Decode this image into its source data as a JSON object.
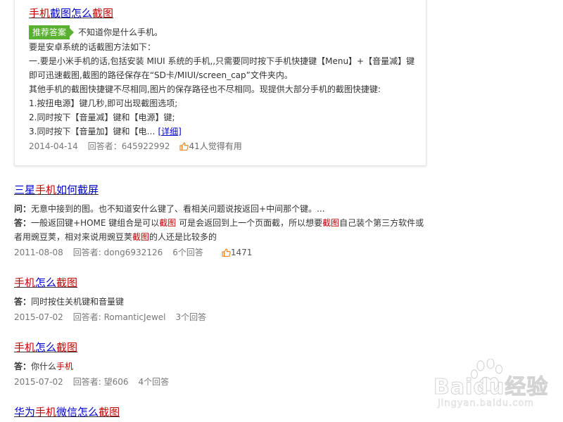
{
  "featured": {
    "title_parts": [
      {
        "text": "手机",
        "hl": true
      },
      {
        "text": "截图",
        "hl": false
      },
      {
        "text": "怎么",
        "hl": false
      },
      {
        "text": "截图",
        "hl": true
      }
    ],
    "badge": "推荐答案",
    "intro": "不知道你是什么手机。",
    "lines": [
      "要是安卓系统的话截图方法如下：",
      "一.要是小米手机的话,包括安装 MIUI 系统的手机,,只需要同时按下手机快捷键【Menu】+【音量减】键即可迅速截图,截图的路径保存在“SD卡/MIUI/screen_cap”文件夹内。",
      "其他手机的截图快捷键不尽相同,图片的保存路径也不尽相同。现提供大部分手机的截图快捷键:",
      "1.按扭电源】键几秒,即可出现截图选项;",
      "2.同时按下【音量减】键和【电源】键;"
    ],
    "last_line": "3.同时按下【音量加】键和【电…",
    "more_label": "[详细]",
    "date": "2014-04-14",
    "answerer": "回答者：645922992",
    "useful": "41人觉得有用"
  },
  "results": [
    {
      "title_parts": [
        {
          "text": "三星",
          "hl": false
        },
        {
          "text": "手机",
          "hl": true
        },
        {
          "text": "如何截屏",
          "hl": false
        }
      ],
      "question_label": "问：",
      "question": "无意中接到的图。也不知道安什么键了、看相关问题说按返回+中间那个键。...",
      "answer_label": "答：",
      "answer_parts": [
        {
          "text": "一般返回键+HOME 键组合是可以",
          "hl": false
        },
        {
          "text": "截图",
          "hl": true
        },
        {
          "text": " 可是会返回到上一个页面截，所以想要",
          "hl": false
        },
        {
          "text": "截图",
          "hl": true
        },
        {
          "text": "自己装个第三方软件或者用豌豆荚，相对来说用豌豆荚",
          "hl": false
        },
        {
          "text": "截图",
          "hl": true
        },
        {
          "text": "的人还是比较多的",
          "hl": false
        }
      ],
      "date": "2011-08-08",
      "answerer": "回答者: dong6932126",
      "answers": "6个回答",
      "likes": "1471"
    },
    {
      "title_parts": [
        {
          "text": "手机",
          "hl": true
        },
        {
          "text": "怎么",
          "hl": false
        },
        {
          "text": "截图",
          "hl": true
        }
      ],
      "answer_label": "答：",
      "answer_parts": [
        {
          "text": "同时按住关机键和音量键",
          "hl": false
        }
      ],
      "date": "2015-07-02",
      "answerer": "回答者: RomanticJewel",
      "answers": "3个回答"
    },
    {
      "title_parts": [
        {
          "text": "手机",
          "hl": true
        },
        {
          "text": "怎么",
          "hl": false
        },
        {
          "text": "截图",
          "hl": true
        }
      ],
      "answer_label": "答：",
      "answer_parts": [
        {
          "text": "你什么",
          "hl": false
        },
        {
          "text": "手机",
          "hl": true
        }
      ],
      "date": "2015-07-02",
      "answerer": "回答者: 望606",
      "answers": "4个回答"
    },
    {
      "title_parts": [
        {
          "text": "华为",
          "hl": false
        },
        {
          "text": "手机",
          "hl": true
        },
        {
          "text": "微信",
          "hl": false
        },
        {
          "text": "怎么",
          "hl": false
        },
        {
          "text": "截图",
          "hl": true
        }
      ]
    }
  ],
  "watermark": {
    "logo_text": "Baidu经验",
    "sub_text": "jingyan.baidu.com"
  },
  "colors": {
    "highlight": "#c00000",
    "link": "#0000cc",
    "badge": "#5ab131",
    "meta": "#777777"
  }
}
